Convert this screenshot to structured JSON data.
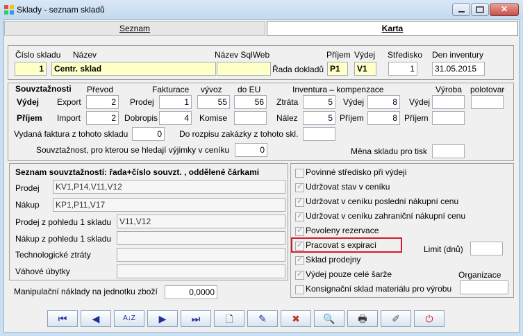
{
  "window": {
    "title": "Sklady - seznam skladů"
  },
  "tabs": {
    "list": "Seznam",
    "card": "Karta"
  },
  "header": {
    "cislo_label": "Číslo skladu",
    "cislo_value": "1",
    "nazev_label": "Název",
    "nazev_value": "Centr. sklad",
    "sqlweb_label": "Název SqlWeb",
    "sqlweb_value": "",
    "rada_label": "Řada dokladů",
    "prijem_label": "Příjem",
    "prijem_value": "P1",
    "vydej_label": "Výdej",
    "vydej_value": "V1",
    "stredisko_label": "Středisko",
    "stredisko_value": "1",
    "inventura_label": "Den inventury",
    "inventura_value": "31.05.2015"
  },
  "souvztaznosti": {
    "title": "Souvztažnosti",
    "col_prevod": "Převod",
    "col_fakturace": "Fakturace",
    "col_vyvoz": "vývoz",
    "col_doeu": "do EU",
    "col_inventura": "Inventura – kompenzace",
    "col_vyroba": "Výroba",
    "col_polotovar": "polotovar",
    "row_vydej": "Výdej",
    "row_prijem": "Příjem",
    "export_label": "Export",
    "export_value": "2",
    "import_label": "Import",
    "import_value": "2",
    "prodej_label": "Prodej",
    "prodej_value": "1",
    "dobropis_label": "Dobropis",
    "dobropis_value": "4",
    "vyvoz_value": "55",
    "doeu_value": "56",
    "komise_label": "Komise",
    "komise_value": "",
    "ztrata_label": "Ztráta",
    "ztrata_value": "5",
    "nalez_label": "Nález",
    "nalez_value": "5",
    "inv_vydej_label": "Výdej",
    "inv_vydej_value": "8",
    "inv_prijem_label": "Příjem",
    "inv_prijem_value": "8",
    "vyroba_vydej_label": "Výdej",
    "vyroba_prijem_label": "Příjem",
    "faktura_label": "Vydaná faktura z tohoto skladu",
    "faktura_value": "0",
    "rozpis_label": "Do rozpisu zakázky z tohoto skl.",
    "vyjimky_label": "Souvztažnost, pro kterou se hledají výjimky v ceníku",
    "vyjimky_value": "0",
    "mena_label": "Měna skladu pro tisk"
  },
  "seznam": {
    "title": "Seznam souvztažností: řada+číslo souvzt. , oddělené čárkami",
    "prodej_label": "Prodej",
    "prodej_value": "KV1,P14,V11,V12",
    "nakup_label": "Nákup",
    "nakup_value": "KP1,P11,V17",
    "prodej1_label": "Prodej z pohledu 1 skladu",
    "prodej1_value": "V11,V12",
    "nakup1_label": "Nákup z pohledu 1 skladu",
    "nakup1_value": "",
    "tech_label": "Technologické ztráty",
    "tech_value": "",
    "vahove_label": "Váhové úbytky",
    "vahove_value": ""
  },
  "manipulacni": {
    "label": "Manipulační náklady na jednotku zboží",
    "value": "0,0000"
  },
  "options": [
    {
      "label": "Povinné středisko při výdeji",
      "checked": false
    },
    {
      "label": "Udržovat stav v ceníku",
      "checked": true
    },
    {
      "label": "Udržovat v ceníku poslední nákupní cenu",
      "checked": true
    },
    {
      "label": "Udržovat v ceníku zahraniční nákupní cenu",
      "checked": true
    },
    {
      "label": "Povoleny rezervace",
      "checked": true
    },
    {
      "label": "Pracovat s expirací",
      "checked": true
    },
    {
      "label": "Sklad prodejny",
      "checked": true
    },
    {
      "label": "Výdej pouze celé šarže",
      "checked": true
    },
    {
      "label": "Konsignační sklad materiálu pro výrobu",
      "checked": false
    }
  ],
  "limit": {
    "label": "Limit (dnů)",
    "value": ""
  },
  "organizace": {
    "label": "Organizace",
    "value": ""
  },
  "toolbar": {
    "first": "⏮",
    "prev": "◀",
    "sort": "A↓Z",
    "next": "▶",
    "last": "⏭",
    "new": "🗋",
    "edit": "✎",
    "delete": "✖",
    "find": "🔍",
    "print": "🖶",
    "pen": "✐",
    "power": "⏻"
  },
  "colors": {
    "accent_yellow": "#ffffc8",
    "highlight_red": "#d11c2a",
    "titlebar": "#c9dff3"
  }
}
